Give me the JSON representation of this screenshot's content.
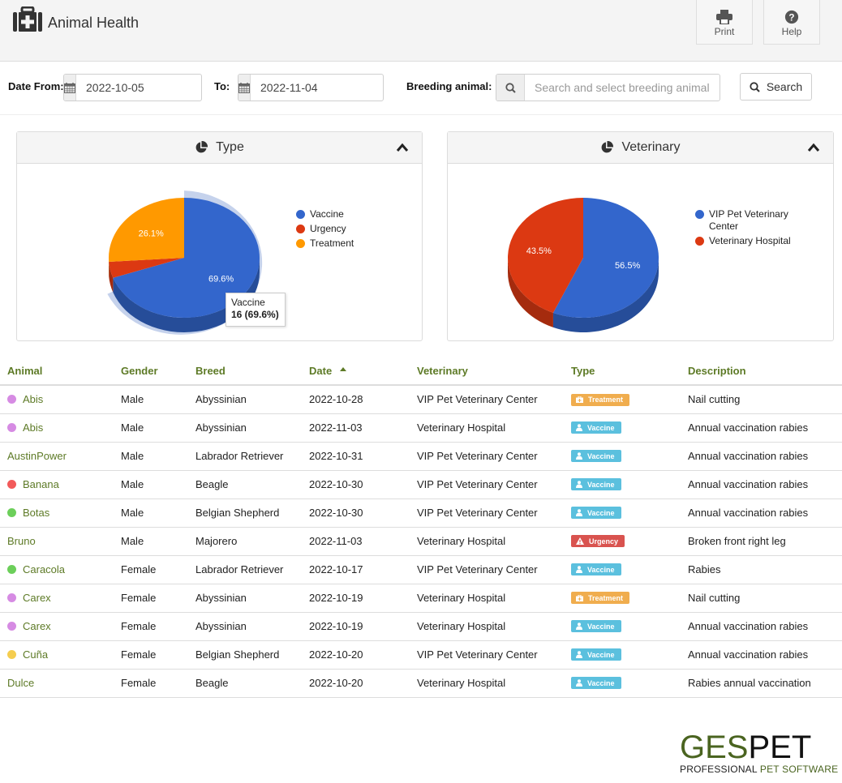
{
  "header": {
    "title": "Animal Health",
    "icon": "medkit-icon",
    "buttons": [
      {
        "label": "Print",
        "icon": "print-icon"
      },
      {
        "label": "Help",
        "icon": "question-circle-icon"
      }
    ]
  },
  "filters": {
    "date_from_label": "Date From:",
    "date_from_value": "2022-10-05",
    "to_label": "To:",
    "date_to_value": "2022-11-04",
    "breeding_label": "Breeding animal:",
    "breeding_placeholder": "Search and select breeding animal",
    "search_button": "Search"
  },
  "panels": {
    "type_title": "Type",
    "vet_title": "Veterinary",
    "tooltip_title": "Vaccine",
    "tooltip_value": "16 (69.6%)"
  },
  "chart_data": [
    {
      "type": "pie",
      "title": "Type",
      "categories": [
        "Vaccine",
        "Urgency",
        "Treatment"
      ],
      "values": [
        16,
        1,
        6
      ],
      "percent_labels": [
        "69.6%",
        "",
        "26.1%"
      ],
      "colors": [
        "#3366cc",
        "#dc3912",
        "#ff9900"
      ],
      "legend": "right",
      "highlighted": "Vaccine"
    },
    {
      "type": "pie",
      "title": "Veterinary",
      "categories": [
        "VIP Pet Veterinary Center",
        "Veterinary Hospital"
      ],
      "values": [
        13,
        10
      ],
      "percent_labels": [
        "56.5%",
        "43.5%"
      ],
      "colors": [
        "#3366cc",
        "#dc3912"
      ],
      "legend": "right"
    }
  ],
  "table": {
    "columns": [
      "Animal",
      "Gender",
      "Breed",
      "Date",
      "Veterinary",
      "Type",
      "Description"
    ],
    "sorted_column": "Date",
    "rows": [
      {
        "animal": "Abis",
        "dot": "#d68be3",
        "gender": "Male",
        "breed": "Abyssinian",
        "date": "2022-10-28",
        "vet": "VIP Pet Veterinary Center",
        "type": "Treatment",
        "desc": "Nail cutting"
      },
      {
        "animal": "Abis",
        "dot": "#d68be3",
        "gender": "Male",
        "breed": "Abyssinian",
        "date": "2022-11-03",
        "vet": "Veterinary Hospital",
        "type": "Vaccine",
        "desc": "Annual vaccination rabies"
      },
      {
        "animal": "AustinPower",
        "dot": "",
        "gender": "Male",
        "breed": "Labrador Retriever",
        "date": "2022-10-31",
        "vet": "VIP Pet Veterinary Center",
        "type": "Vaccine",
        "desc": "Annual vaccination rabies"
      },
      {
        "animal": "Banana",
        "dot": "#f25a5a",
        "gender": "Male",
        "breed": "Beagle",
        "date": "2022-10-30",
        "vet": "VIP Pet Veterinary Center",
        "type": "Vaccine",
        "desc": "Annual vaccination rabies"
      },
      {
        "animal": "Botas",
        "dot": "#6ccf5a",
        "gender": "Male",
        "breed": "Belgian Shepherd",
        "date": "2022-10-30",
        "vet": "VIP Pet Veterinary Center",
        "type": "Vaccine",
        "desc": "Annual vaccination rabies"
      },
      {
        "animal": "Bruno",
        "dot": "",
        "gender": "Male",
        "breed": "Majorero",
        "date": "2022-11-03",
        "vet": "Veterinary Hospital",
        "type": "Urgency",
        "desc": "Broken front right leg"
      },
      {
        "animal": "Caracola",
        "dot": "#6ccf5a",
        "gender": "Female",
        "breed": "Labrador Retriever",
        "date": "2022-10-17",
        "vet": "VIP Pet Veterinary Center",
        "type": "Vaccine",
        "desc": "Rabies"
      },
      {
        "animal": "Carex",
        "dot": "#d68be3",
        "gender": "Female",
        "breed": "Abyssinian",
        "date": "2022-10-19",
        "vet": "Veterinary Hospital",
        "type": "Treatment",
        "desc": "Nail cutting"
      },
      {
        "animal": "Carex",
        "dot": "#d68be3",
        "gender": "Female",
        "breed": "Abyssinian",
        "date": "2022-10-19",
        "vet": "Veterinary Hospital",
        "type": "Vaccine",
        "desc": "Annual vaccination rabies"
      },
      {
        "animal": "Cuña",
        "dot": "#f5cd4f",
        "gender": "Female",
        "breed": "Belgian Shepherd",
        "date": "2022-10-20",
        "vet": "VIP Pet Veterinary Center",
        "type": "Vaccine",
        "desc": "Annual vaccination rabies"
      },
      {
        "animal": "Dulce",
        "dot": "",
        "gender": "Female",
        "breed": "Beagle",
        "date": "2022-10-20",
        "vet": "Veterinary Hospital",
        "type": "Vaccine",
        "desc": "Rabies annual vaccination"
      }
    ]
  },
  "badge_styles": {
    "Treatment": {
      "color": "#f0ad4e",
      "icon": "medkit-icon"
    },
    "Vaccine": {
      "color": "#5bc0de",
      "icon": "user-md-icon"
    },
    "Urgency": {
      "color": "#d9534f",
      "icon": "warning-icon"
    }
  },
  "brand": {
    "logo_part1": "GES",
    "logo_part2": "PET",
    "tagline_part1": "PROFESSIONAL ",
    "tagline_part2": "PET SOFTWARE"
  }
}
